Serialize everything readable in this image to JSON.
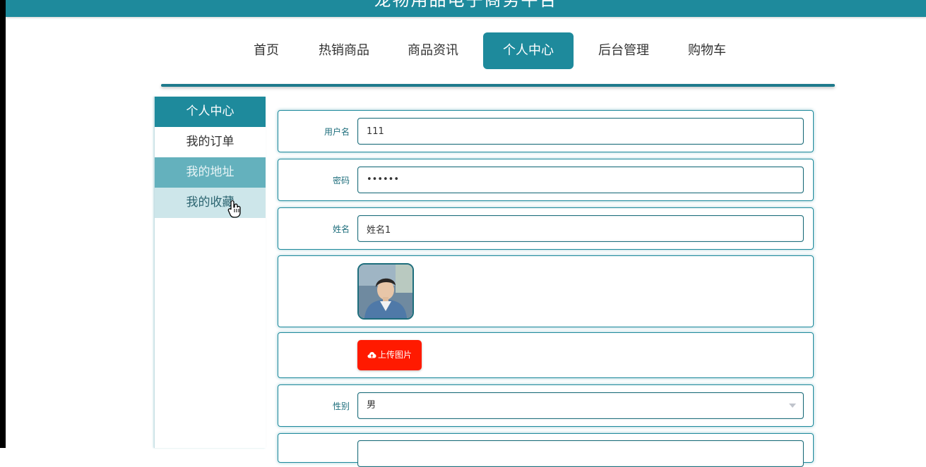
{
  "header": {
    "site_title": "宠物用品电子商务平台"
  },
  "nav": {
    "items": [
      {
        "label": "首页"
      },
      {
        "label": "热销商品"
      },
      {
        "label": "商品资讯"
      },
      {
        "label": "个人中心",
        "active": true
      },
      {
        "label": "后台管理"
      },
      {
        "label": "购物车"
      }
    ]
  },
  "sidebar": {
    "items": [
      {
        "label": "个人中心",
        "state": "header"
      },
      {
        "label": "我的订单",
        "state": "normal"
      },
      {
        "label": "我的地址",
        "state": "selected"
      },
      {
        "label": "我的收藏",
        "state": "hover"
      }
    ]
  },
  "form": {
    "username": {
      "label": "用户名",
      "value": "111"
    },
    "password": {
      "label": "密码",
      "value": "••••••"
    },
    "name": {
      "label": "姓名",
      "value": "姓名1"
    },
    "avatar": {
      "icon": "user-photo"
    },
    "upload": {
      "label": "上传图片",
      "icon": "cloud-upload-icon"
    },
    "gender": {
      "label": "性别",
      "value": "男"
    }
  },
  "colors": {
    "primary": "#1e8a9c",
    "upload_button": "#ff1a00",
    "sidebar_selected": "#64b1bd",
    "sidebar_hover": "#cde6ea"
  }
}
